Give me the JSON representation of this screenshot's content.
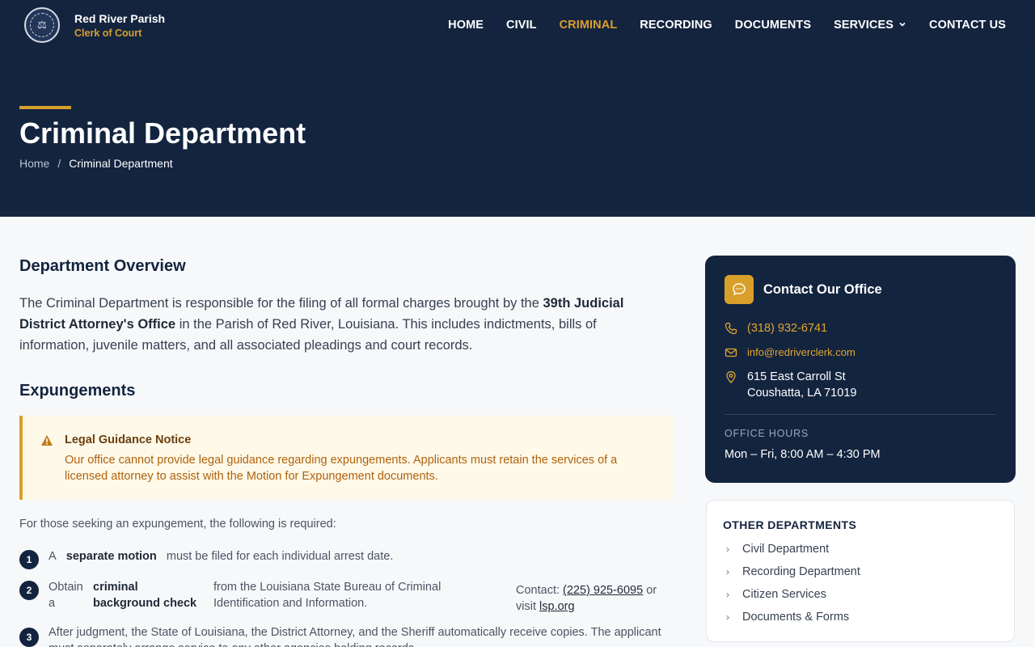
{
  "header": {
    "brand_title": "Red River Parish",
    "brand_subtitle": "Clerk of Court",
    "logo_icon": "parish-seal",
    "nav": [
      {
        "label": "HOME",
        "active": false
      },
      {
        "label": "CIVIL",
        "active": false
      },
      {
        "label": "CRIMINAL",
        "active": true
      },
      {
        "label": "RECORDING",
        "active": false
      },
      {
        "label": "DOCUMENTS",
        "active": false
      },
      {
        "label": "SERVICES",
        "active": false,
        "dropdown": true
      },
      {
        "label": "CONTACT US",
        "active": false
      }
    ]
  },
  "hero": {
    "title": "Criminal Department",
    "breadcrumb": {
      "home": "Home",
      "separator": "/",
      "current": "Criminal Department"
    }
  },
  "overview": {
    "heading": "Department Overview",
    "text_1": "The Criminal Department is responsible for the filing of all formal charges brought by the",
    "text_bold": "39th Judicial District Attorney's Office",
    "text_2": "in the Parish of Red River, Louisiana. This includes indictments, bills of information, juvenile matters, and all associated pleadings and court records."
  },
  "expungements": {
    "heading": "Expungements",
    "notice": {
      "icon": "warning-icon",
      "title": "Legal Guidance Notice",
      "body": "Our office cannot provide legal guidance regarding expungements. Applicants must retain the services of a licensed attorney to assist with the Motion for Expungement documents."
    },
    "intro": "For those seeking an expungement, the following is required:",
    "steps": [
      {
        "num": "1",
        "pre": "A",
        "bold": "separate motion",
        "post": "must be filed for each individual arrest date."
      },
      {
        "num": "2",
        "pre": "Obtain a",
        "bold": "criminal background check",
        "post": "from the Louisiana State Bureau of Criminal Identification and Information.",
        "contact_label": "Contact:",
        "phone": "(225) 925-6095",
        "or_visit": "or visit",
        "link": "lsp.org"
      },
      {
        "num": "3",
        "text": "After judgment, the State of Louisiana, the District Attorney, and the Sheriff automatically receive copies. The applicant must separately arrange service to any other agencies holding records."
      }
    ]
  },
  "contact_card": {
    "title": "Contact Our Office",
    "phone": "(318) 932-6741",
    "email": "info@redriverclerk.com",
    "address_line1": "615 East Carroll St",
    "address_line2": "Coushatta, LA 71019",
    "hours_label": "OFFICE HOURS",
    "hours": "Mon – Fri, 8:00 AM – 4:30 PM"
  },
  "other_departments": {
    "title": "OTHER DEPARTMENTS",
    "items": [
      "Civil Department",
      "Recording Department",
      "Citizen Services",
      "Documents & Forms"
    ]
  },
  "colors": {
    "navy": "#13243f",
    "gold": "#d99f2b",
    "page_bg": "#f7f8fa",
    "notice_bg": "#fef9e8"
  }
}
